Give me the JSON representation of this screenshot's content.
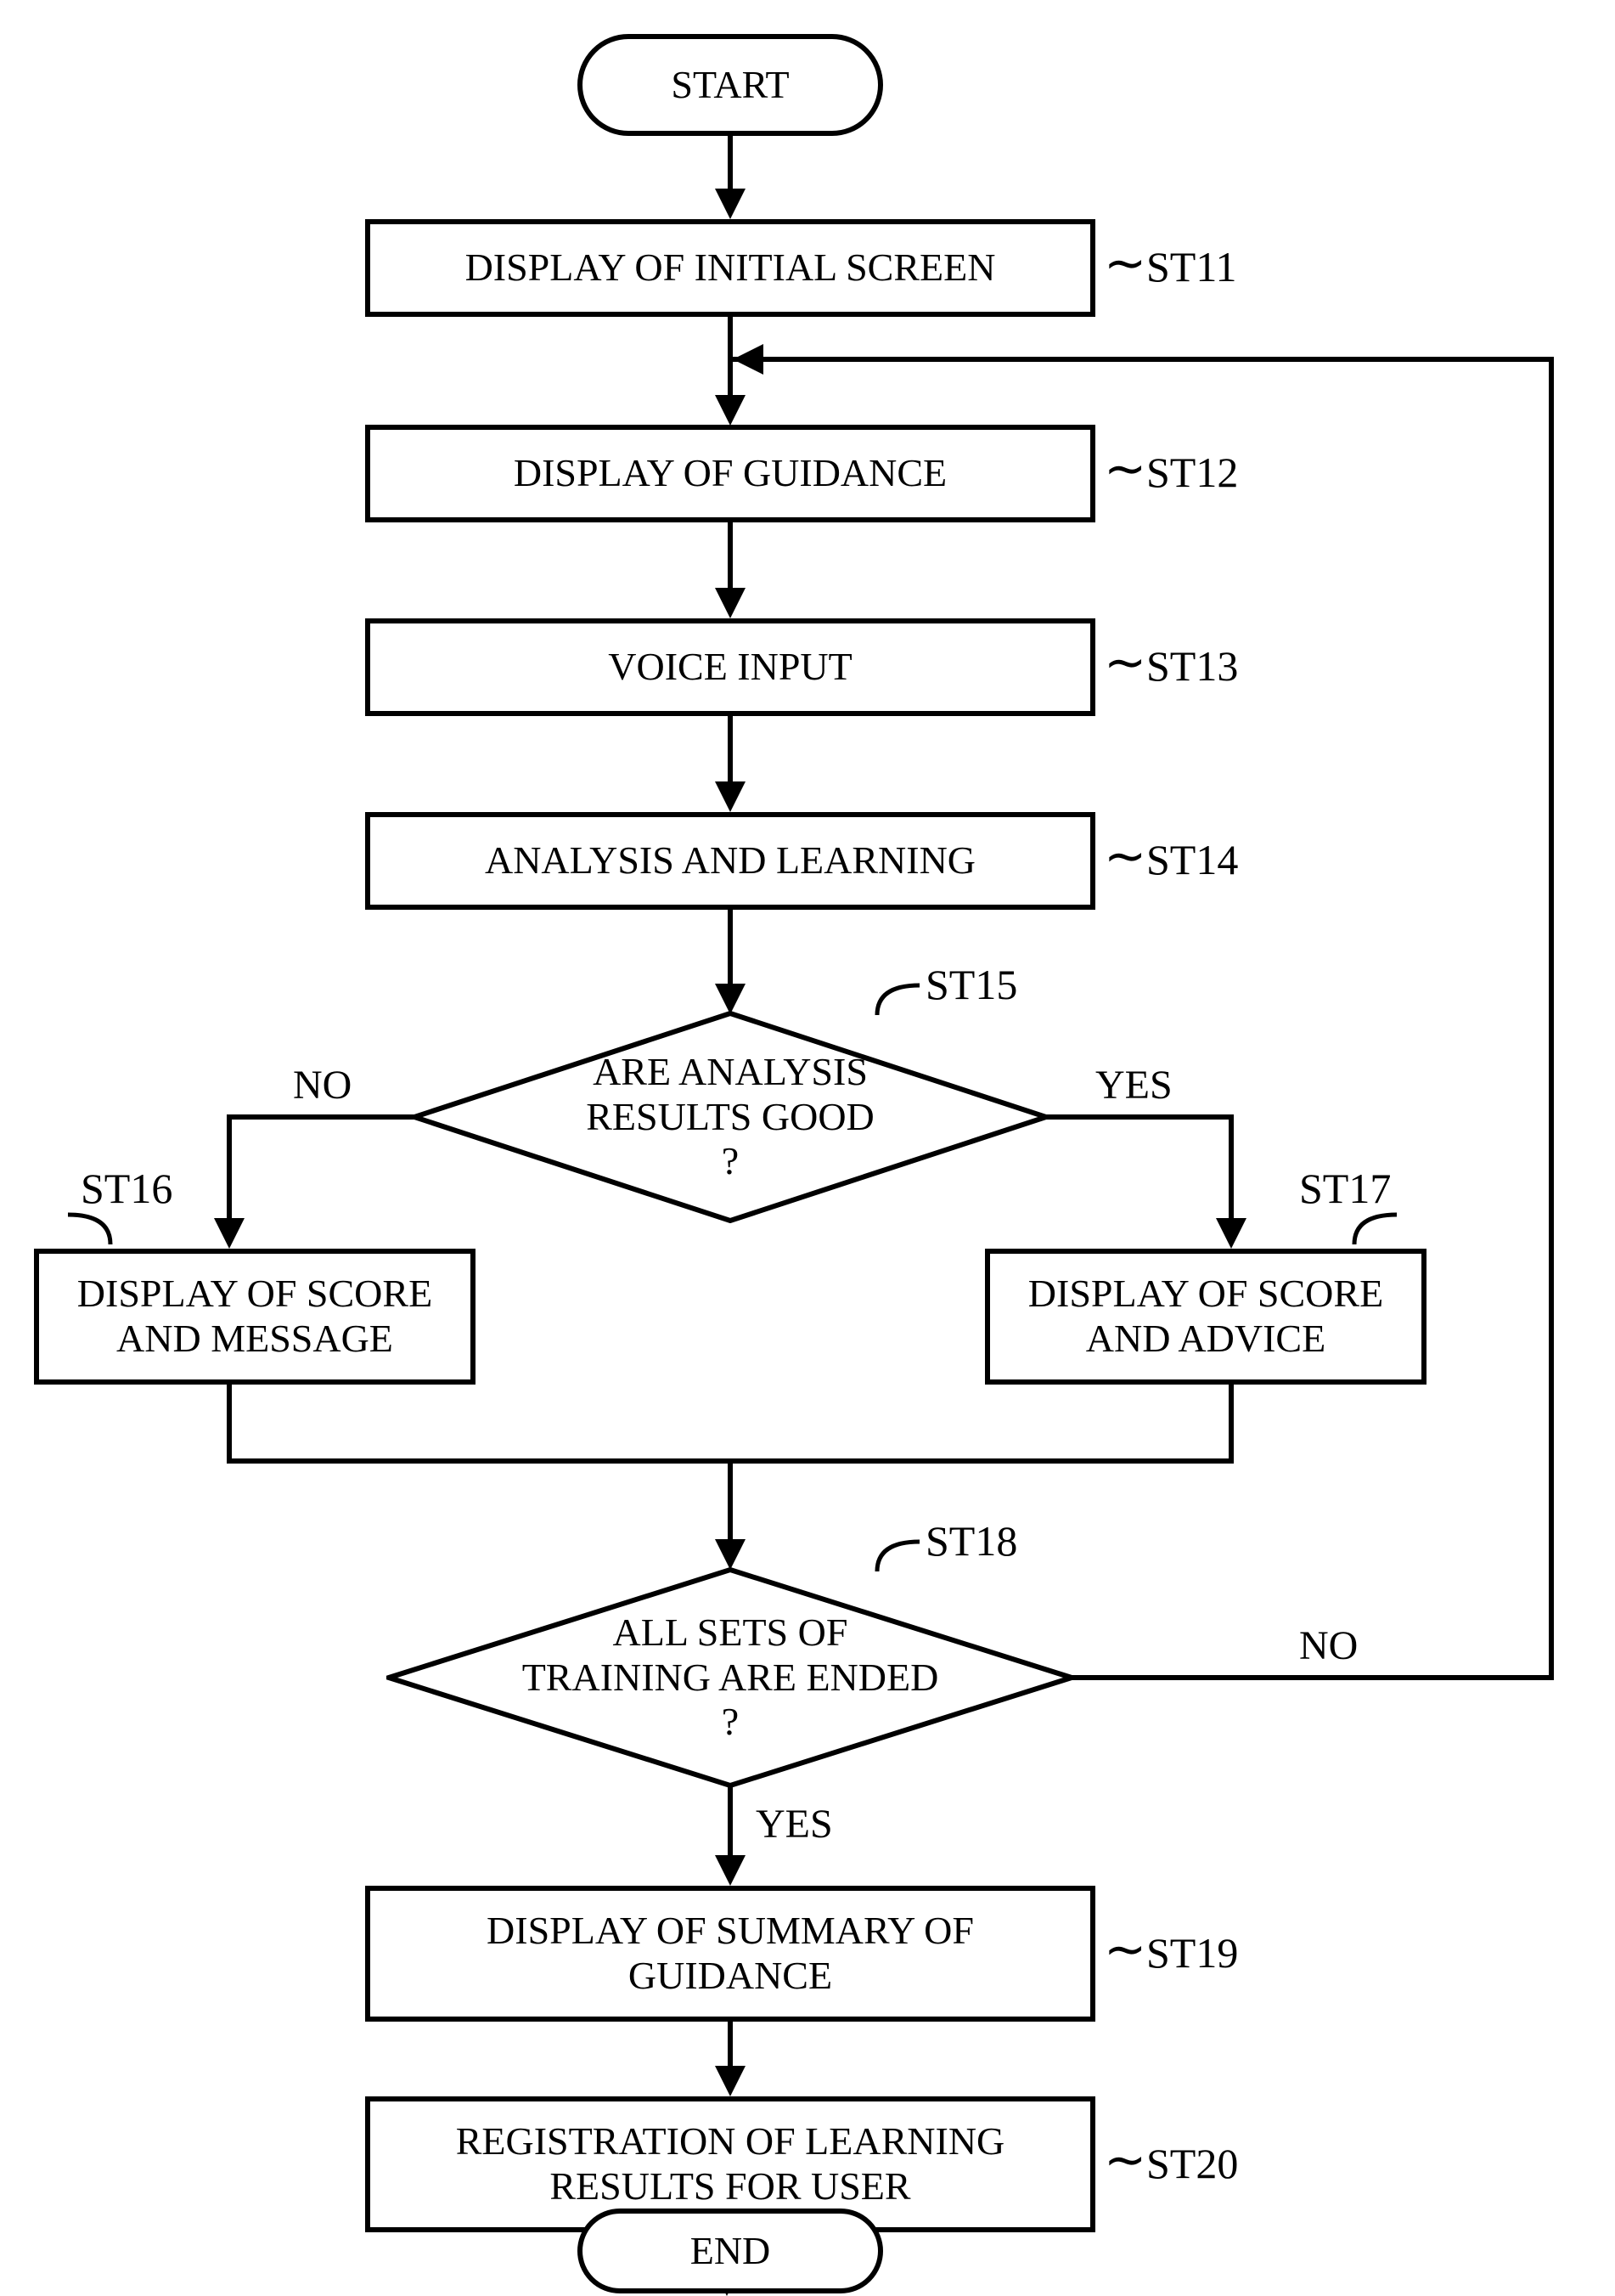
{
  "chart_data": {
    "type": "flowchart",
    "title": "",
    "nodes": [
      {
        "id": "start",
        "type": "terminal",
        "text": "START"
      },
      {
        "id": "st11",
        "type": "process",
        "text": "DISPLAY OF INITIAL SCREEN",
        "tag": "ST11"
      },
      {
        "id": "st12",
        "type": "process",
        "text": "DISPLAY OF GUIDANCE",
        "tag": "ST12"
      },
      {
        "id": "st13",
        "type": "process",
        "text": "VOICE INPUT",
        "tag": "ST13"
      },
      {
        "id": "st14",
        "type": "process",
        "text": "ANALYSIS AND LEARNING",
        "tag": "ST14"
      },
      {
        "id": "st15",
        "type": "decision",
        "text": "ARE ANALYSIS\nRESULTS GOOD\n?",
        "tag": "ST15"
      },
      {
        "id": "st16",
        "type": "process",
        "text": "DISPLAY OF SCORE\nAND MESSAGE",
        "tag": "ST16"
      },
      {
        "id": "st17",
        "type": "process",
        "text": "DISPLAY OF SCORE\nAND ADVICE",
        "tag": "ST17"
      },
      {
        "id": "st18",
        "type": "decision",
        "text": "ALL SETS OF\nTRAINING ARE ENDED\n?",
        "tag": "ST18"
      },
      {
        "id": "st19",
        "type": "process",
        "text": "DISPLAY OF SUMMARY OF\nGUIDANCE",
        "tag": "ST19"
      },
      {
        "id": "st20",
        "type": "process",
        "text": "REGISTRATION OF LEARNING\nRESULTS FOR USER",
        "tag": "ST20"
      },
      {
        "id": "end",
        "type": "terminal",
        "text": "END"
      }
    ],
    "edges": [
      {
        "from": "start",
        "to": "st11"
      },
      {
        "from": "st11",
        "to": "st12"
      },
      {
        "from": "st12",
        "to": "st13"
      },
      {
        "from": "st13",
        "to": "st14"
      },
      {
        "from": "st14",
        "to": "st15"
      },
      {
        "from": "st15",
        "to": "st16",
        "label": "NO"
      },
      {
        "from": "st15",
        "to": "st17",
        "label": "YES"
      },
      {
        "from": "st16",
        "to": "st18"
      },
      {
        "from": "st17",
        "to": "st18"
      },
      {
        "from": "st18",
        "to": "st19",
        "label": "YES"
      },
      {
        "from": "st18",
        "to": "st12",
        "label": "NO"
      },
      {
        "from": "st19",
        "to": "st20"
      },
      {
        "from": "st20",
        "to": "end"
      }
    ],
    "edge_labels": {
      "yes": "YES",
      "no": "NO"
    }
  }
}
